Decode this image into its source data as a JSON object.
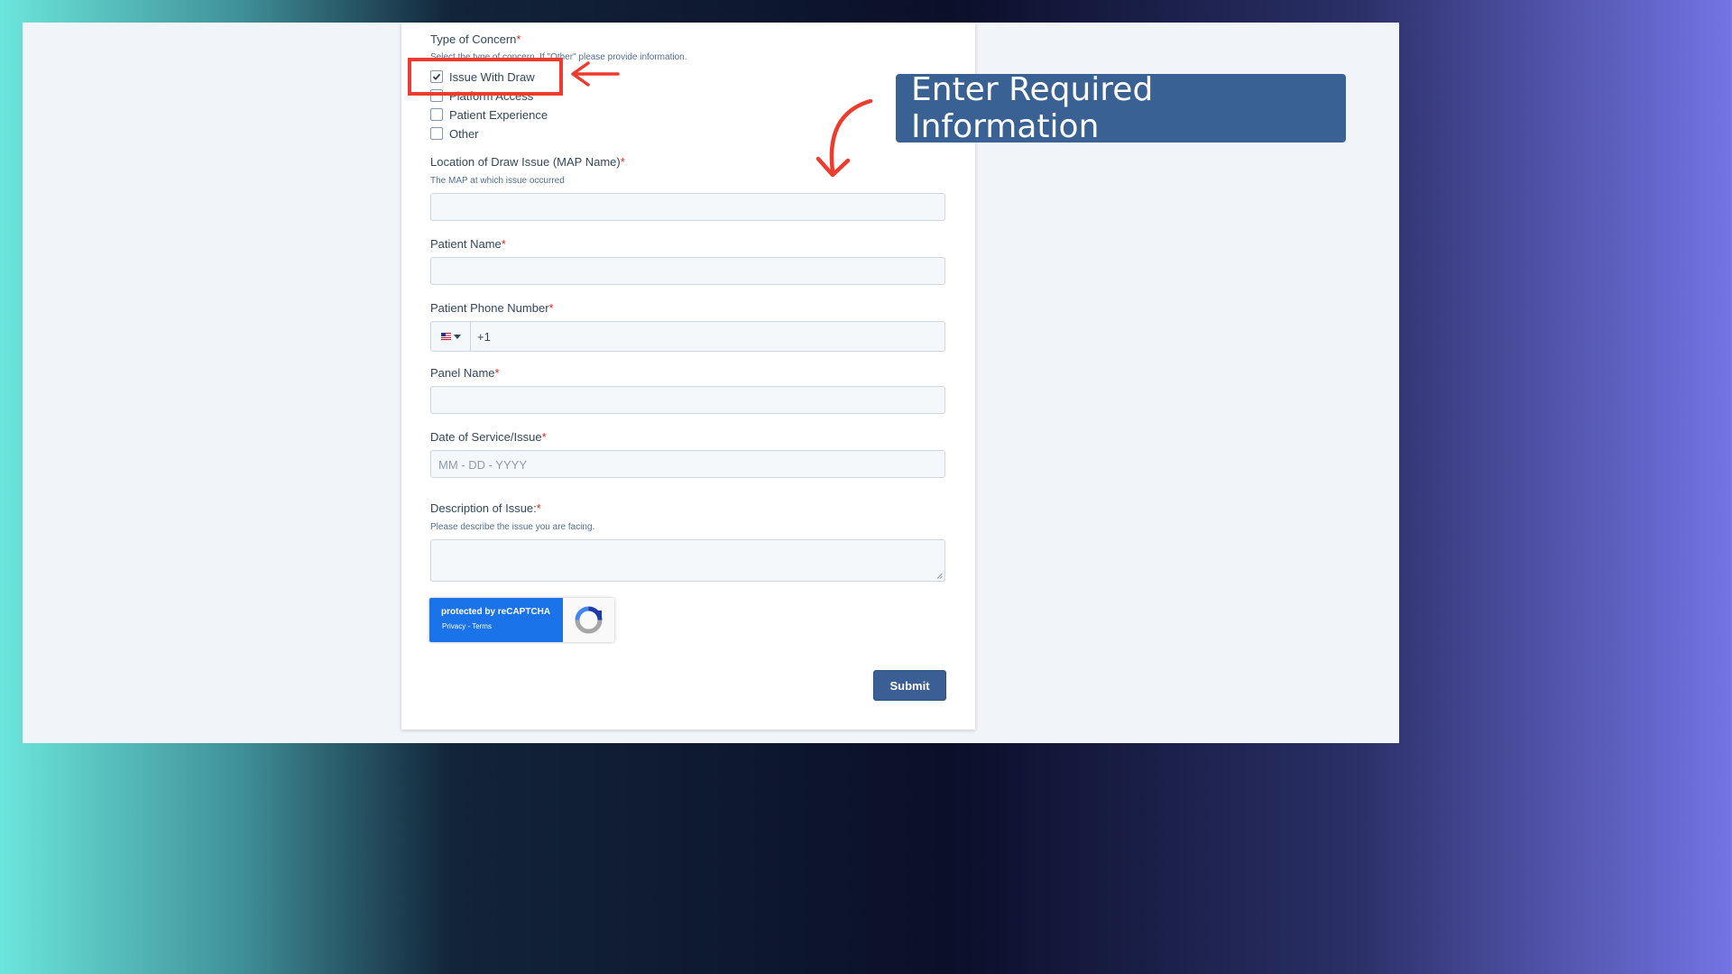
{
  "form": {
    "type_of_concern": {
      "label": "Type of Concern",
      "required_mark": "*",
      "help": "Select the type of concern. If \"Other\" please provide information.",
      "options": [
        {
          "label": "Issue With Draw",
          "checked": true
        },
        {
          "label": "Platform Access",
          "checked": false
        },
        {
          "label": "Patient Experience",
          "checked": false
        },
        {
          "label": "Other",
          "checked": false
        }
      ]
    },
    "location": {
      "label": "Location of Draw Issue (MAP Name)",
      "required_mark": "*",
      "help": "The MAP at which issue occurred",
      "value": ""
    },
    "patient_name": {
      "label": "Patient Name",
      "required_mark": "*",
      "value": ""
    },
    "patient_phone": {
      "label": "Patient Phone Number",
      "required_mark": "*",
      "country_flag_icon": "us-flag-icon",
      "value": "+1"
    },
    "panel_name": {
      "label": "Panel Name",
      "required_mark": "*",
      "value": ""
    },
    "date_of_service": {
      "label": "Date of Service/Issue",
      "required_mark": "*",
      "placeholder": "MM - DD - YYYY"
    },
    "description": {
      "label": "Description of Issue:",
      "required_mark": "*",
      "help": "Please describe the issue you are facing.",
      "value": ""
    },
    "recaptcha": {
      "title": "protected by reCAPTCHA",
      "links": "Privacy - Terms",
      "logo_icon": "recaptcha-logo-icon"
    },
    "submit_label": "Submit"
  },
  "annotations": {
    "callout_text": "Enter Required Information",
    "callout_color": "#3a6194",
    "highlight_color": "#ef3b2d",
    "arrow_color": "#ef3b2d"
  }
}
